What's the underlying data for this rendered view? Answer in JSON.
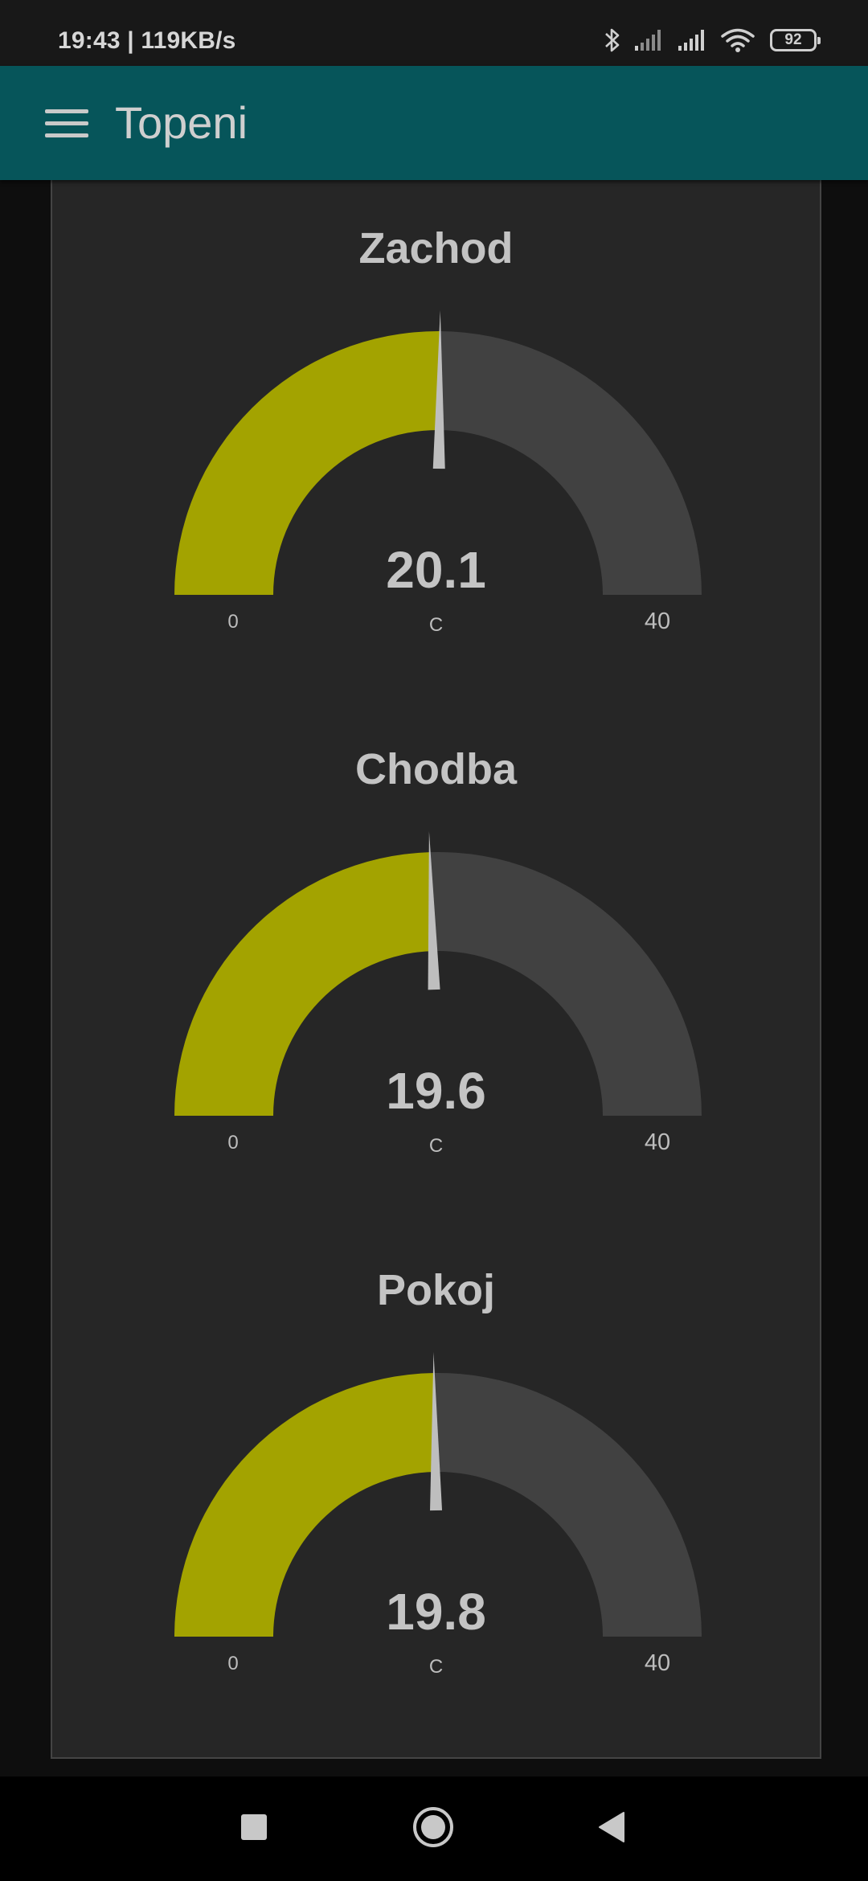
{
  "status_bar": {
    "time_speed": "19:43 | 119KB/s",
    "battery": "92",
    "icons": [
      "bluetooth-icon",
      "signal-icon",
      "signal-icon",
      "wifi-icon",
      "battery-icon"
    ]
  },
  "app_bar": {
    "title": "Topeni",
    "menu_icon": "hamburger-menu-icon"
  },
  "colors": {
    "app_bar": "#06555a",
    "gauge_fill": "#a3a300",
    "gauge_track": "#414141",
    "needle": "#bebebe",
    "card": "#262626"
  },
  "gauges": [
    {
      "title": "Zachod",
      "value": 20.1,
      "value_label": "20.1",
      "unit": "C",
      "min": 0,
      "max": 40,
      "min_label": "0",
      "max_label": "40"
    },
    {
      "title": "Chodba",
      "value": 19.6,
      "value_label": "19.6",
      "unit": "C",
      "min": 0,
      "max": 40,
      "min_label": "0",
      "max_label": "40"
    },
    {
      "title": "Pokoj",
      "value": 19.8,
      "value_label": "19.8",
      "unit": "C",
      "min": 0,
      "max": 40,
      "min_label": "0",
      "max_label": "40"
    }
  ],
  "nav_bar": {
    "icons": [
      "recents-square-icon",
      "home-circle-icon",
      "back-triangle-icon"
    ]
  }
}
